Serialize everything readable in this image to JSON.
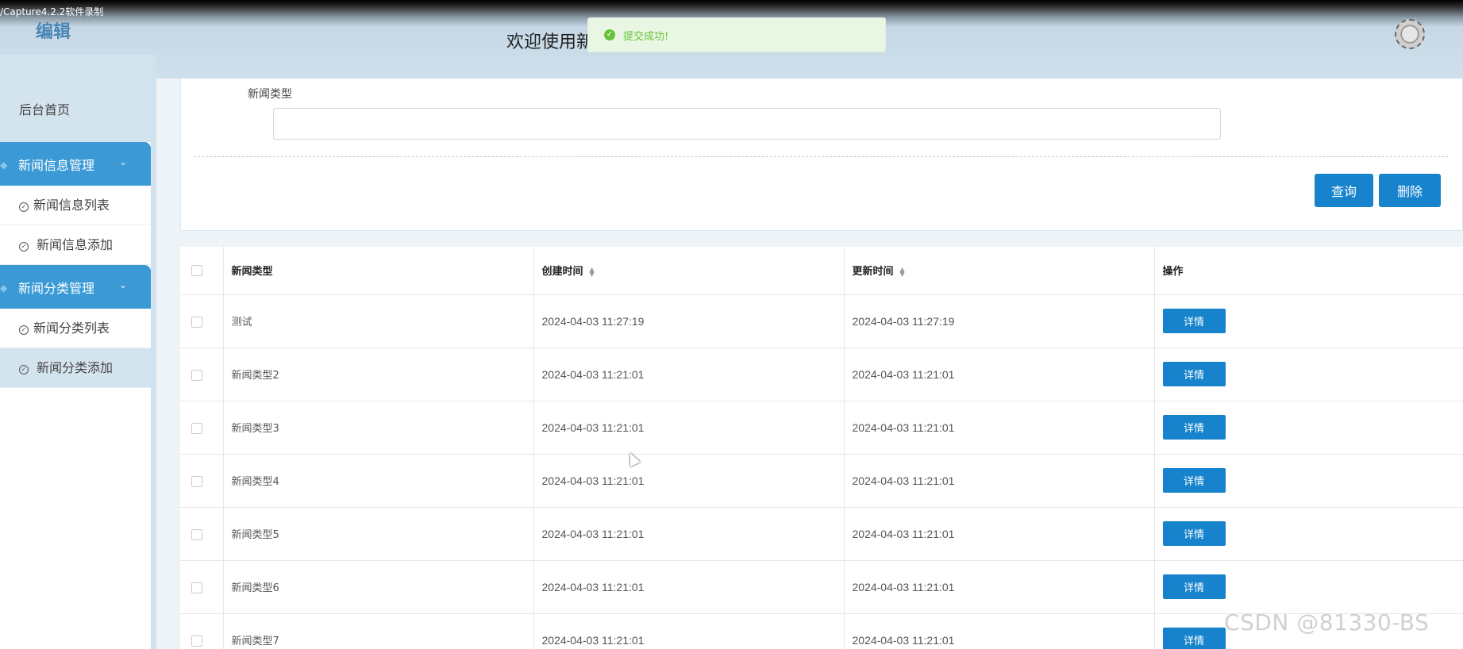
{
  "recorder_watermark": "/Capture4.2.2软件录制",
  "header": {
    "logo_text": "编辑",
    "welcome_text": "欢迎使用新",
    "toast_message": "提交成功!"
  },
  "sidebar": {
    "home": "后台首页",
    "groups": [
      {
        "label": "新闻信息管理",
        "items": [
          "新闻信息列表",
          "新闻信息添加"
        ]
      },
      {
        "label": "新闻分类管理",
        "items": [
          "新闻分类列表",
          "新闻分类添加"
        ]
      }
    ]
  },
  "search": {
    "label": "新闻类型",
    "value": "",
    "query_button": "查询",
    "delete_button": "删除"
  },
  "table": {
    "columns": [
      "新闻类型",
      "创建时间",
      "更新时间",
      "操作"
    ],
    "detail_label": "详情",
    "rows": [
      {
        "type": "测试",
        "created": "2024-04-03 11:27:19",
        "updated": "2024-04-03 11:27:19"
      },
      {
        "type": "新闻类型2",
        "created": "2024-04-03 11:21:01",
        "updated": "2024-04-03 11:21:01"
      },
      {
        "type": "新闻类型3",
        "created": "2024-04-03 11:21:01",
        "updated": "2024-04-03 11:21:01"
      },
      {
        "type": "新闻类型4",
        "created": "2024-04-03 11:21:01",
        "updated": "2024-04-03 11:21:01"
      },
      {
        "type": "新闻类型5",
        "created": "2024-04-03 11:21:01",
        "updated": "2024-04-03 11:21:01"
      },
      {
        "type": "新闻类型6",
        "created": "2024-04-03 11:21:01",
        "updated": "2024-04-03 11:21:01"
      },
      {
        "type": "新闻类型7",
        "created": "2024-04-03 11:21:01",
        "updated": "2024-04-03 11:21:01"
      }
    ]
  },
  "footer_watermark": "CSDN @81330-BS",
  "colors": {
    "primary": "#1683cc",
    "sidebar_group": "#3b9ad6",
    "success": "#67c23a"
  }
}
